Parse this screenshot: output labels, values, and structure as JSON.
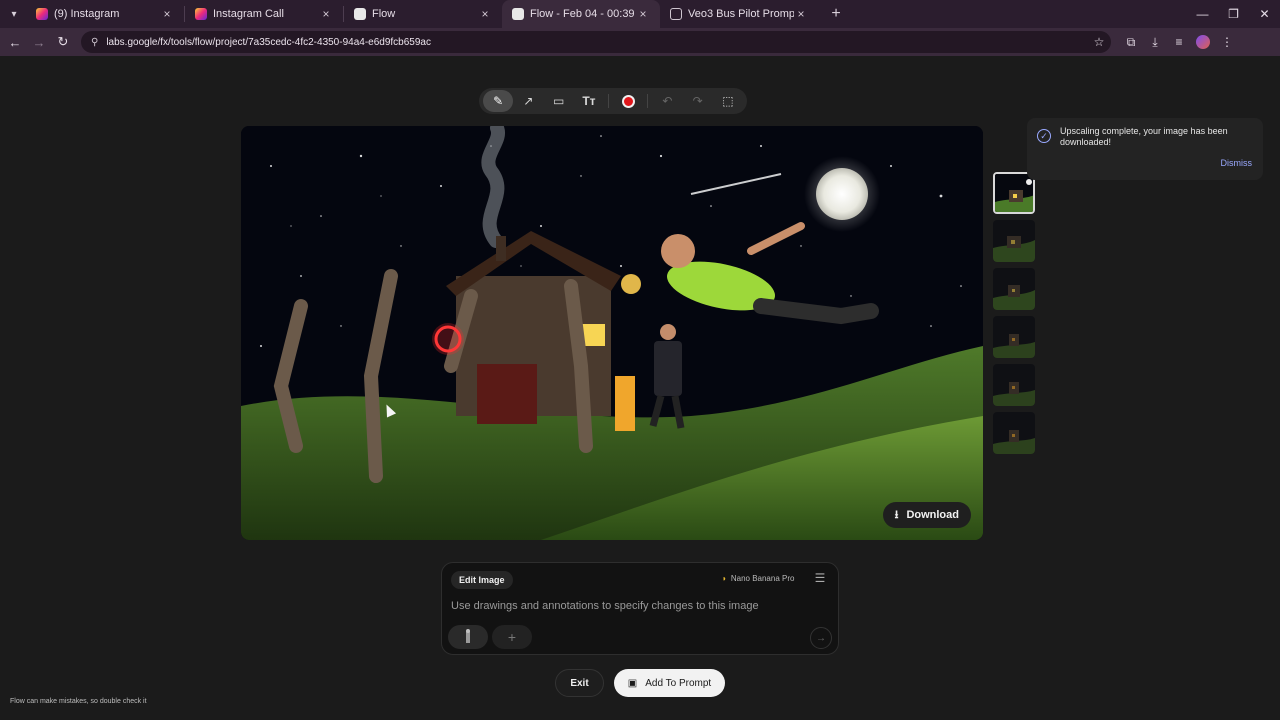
{
  "browser": {
    "tabs": [
      {
        "title": "(9) Instagram",
        "icon": "instagram-icon",
        "active": false
      },
      {
        "title": "Instagram Call",
        "icon": "instagram-icon",
        "active": false
      },
      {
        "title": "Flow",
        "icon": "flow-icon",
        "active": false
      },
      {
        "title": "Flow - Feb 04 - 00:39",
        "icon": "flow-icon",
        "active": true
      },
      {
        "title": "Veo3 Bus Pilot Prompt",
        "icon": "globe-icon",
        "active": false
      }
    ],
    "url": "labs.google/fx/tools/flow/project/7a35cedc-4fc2-4350-94a4-e6d9fcb659ac"
  },
  "toast": {
    "message": "Upscaling complete, your image has been downloaded!",
    "dismiss_label": "Dismiss"
  },
  "image_viewer": {
    "download_label": "Download",
    "thumbnail_count": 6,
    "selected_thumbnail": 1
  },
  "prompt": {
    "mode_label": "Edit Image",
    "model_label": "Nano Banana Pro",
    "placeholder": "Use drawings and annotations to specify changes to this image"
  },
  "actions": {
    "exit_label": "Exit",
    "add_to_prompt_label": "Add To Prompt"
  },
  "footer": {
    "disclaimer": "Flow can make mistakes, so double check it"
  }
}
